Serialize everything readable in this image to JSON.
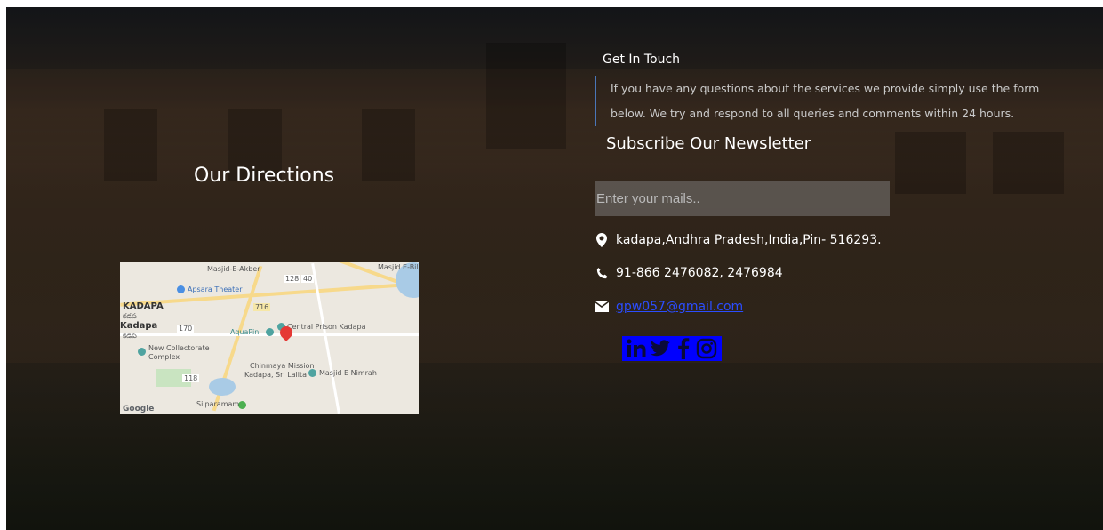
{
  "directions": {
    "title": "Our Directions",
    "map": {
      "labels": {
        "masjid_akber": "Masjid-E-Akber",
        "masjid_bilal": "Masjid E-Bilal",
        "apsara": "Apsara Theater",
        "kadapa_upper": "KADAPA",
        "kadapa_upper_te": "కడప",
        "kadapa": "Kadapa",
        "kadapa_te": "కడప",
        "aquapin": "AquaPin",
        "central_prison": "Central Prison Kadapa",
        "new_collectorate": "New Collectorate",
        "complex": "Complex",
        "chinmaya": "Chinmaya Mission",
        "chinmaya2": "Kadapa, Sri Lalita",
        "masjid_nimrah": "Masjid E Nimrah",
        "silparamam": "Silparamam",
        "google": "Google",
        "road_716": "716",
        "road_170": "170",
        "road_118": "118",
        "road_128": "128",
        "road_40": "40"
      }
    }
  },
  "contact": {
    "title": "Get In Touch",
    "text": "If you have any questions about the services we provide simply use the form below. We try and respond to all queries and comments within 24 hours.",
    "newsletter_title": "Subscribe Our Newsletter",
    "email_placeholder": "Enter your mails..",
    "address": "kadapa,Andhra Pradesh,India,Pin- 516293.",
    "phone": "91-866 2476082, 2476984",
    "email": "gpw057@gmail.com"
  },
  "social": {
    "items": [
      "linkedin",
      "twitter",
      "facebook",
      "instagram"
    ],
    "color": "#0000ff"
  },
  "colors": {
    "link": "#2b4dff",
    "divider": "#4a76b8"
  }
}
